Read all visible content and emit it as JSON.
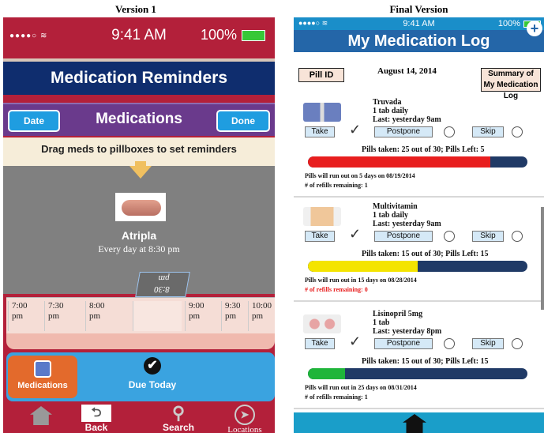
{
  "captions": {
    "left": "Version 1",
    "right": "Final Version"
  },
  "v1": {
    "status": {
      "time": "9:41 AM",
      "battery": "100%"
    },
    "nav_title": "Medication Reminders",
    "bar": {
      "date": "Date",
      "title": "Medications",
      "done": "Done"
    },
    "instruction": "Drag meds to pillboxes to set reminders",
    "drug": {
      "name": "Atripla",
      "schedule": "Every day at 8:30 pm"
    },
    "dragged_tag": {
      "line1": "8:30",
      "line2": "pm"
    },
    "slots": [
      {
        "time": "7:00",
        "ampm": "pm"
      },
      {
        "time": "7:30",
        "ampm": "pm"
      },
      {
        "time": "8:00",
        "ampm": "pm"
      },
      {
        "time": "",
        "ampm": ""
      },
      {
        "time": "9:00",
        "ampm": "pm"
      },
      {
        "time": "9:30",
        "ampm": "pm"
      },
      {
        "time": "10:00",
        "ampm": "pm"
      }
    ],
    "tabs": {
      "medications": "Medications",
      "due_today": "Due Today"
    },
    "bottom": {
      "back": "Back",
      "search": "Search",
      "locations": "Locations"
    },
    "colors": {
      "primary": "#b3203a",
      "nav": "#0f2d6e",
      "accent": "#1f9de0"
    }
  },
  "final": {
    "status": {
      "time": "9:41 AM",
      "battery": "100%"
    },
    "nav_title": "My Medication Log",
    "pill_id": "Pill ID",
    "date": "August 14, 2014",
    "summary": "Summary of My Medication Log",
    "meds": [
      {
        "name": "Truvada",
        "dose": "1 tab daily",
        "last": "Last: yesterday 9am",
        "take": "Take",
        "postpone": "Postpone",
        "skip": "Skip",
        "taken_text": "Pills taken: 25 out of 30; Pills Left: 5",
        "progress": 0.83,
        "color": "#e81e1e",
        "runout": "Pills will run out on  5 days on 08/19/2014",
        "refills": "# of refills remaining: 1",
        "refills_color": "#111111"
      },
      {
        "name": "Multivitamin",
        "dose": "1 tab daily",
        "last": "Last: yesterday 9am",
        "take": "Take",
        "postpone": "Postpone",
        "skip": "Skip",
        "taken_text": "Pills taken: 15 out of 30; Pills Left: 15",
        "progress": 0.5,
        "color": "#f4e400",
        "runout": "Pills will run out in 15 days on 08/28/2014",
        "refills": "# of refills remaining: 0",
        "refills_color": "#e81e1e"
      },
      {
        "name": "Lisinopril 5mg",
        "dose": "1 tab",
        "last": "Last: yesterday 8pm",
        "take": "Take",
        "postpone": "Postpone",
        "skip": "Skip",
        "taken_text": "Pills taken: 15 out of 30; Pills Left: 15",
        "progress": 0.17,
        "color": "#1fb53a",
        "runout": "Pills will run out in 25 days on 08/31/2014",
        "refills": "# of refills remaining: 1",
        "refills_color": "#111111"
      }
    ],
    "colors": {
      "status": "#1a8ec9",
      "nav": "#2466a8",
      "button": "#d5e9f7"
    }
  }
}
